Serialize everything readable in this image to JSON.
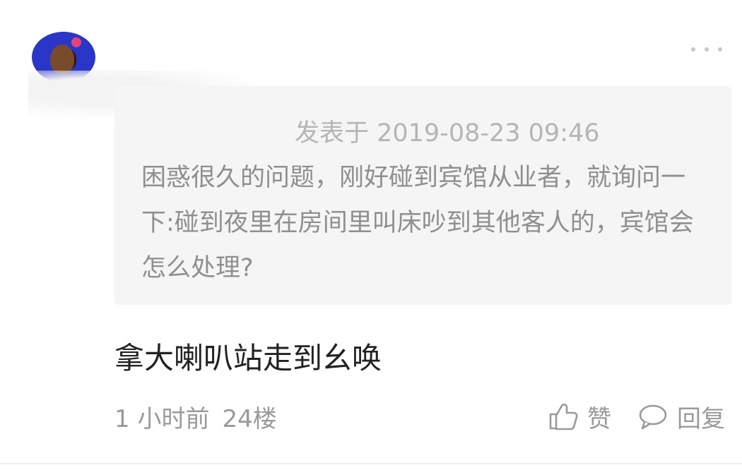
{
  "comment": {
    "quote": {
      "posted_at": "发表于 2019-08-23 09:46",
      "text": "困惑很久的问题，刚好碰到宾馆从业者，就询问一下:碰到夜里在房间里叫床吵到其他客人的，宾馆会怎么处理?"
    },
    "reply_text": "拿大喇叭站走到幺唤",
    "time_ago": "1 小时前",
    "floor": "24楼",
    "like_label": "赞",
    "reply_label": "回复"
  },
  "icons": {
    "more": "more-dots-icon",
    "like": "thumbs-up-icon",
    "reply": "speech-bubble-icon"
  },
  "colors": {
    "quote_background": "#f5f5f5",
    "muted_text": "#9a9a9a",
    "main_text": "#222222"
  }
}
